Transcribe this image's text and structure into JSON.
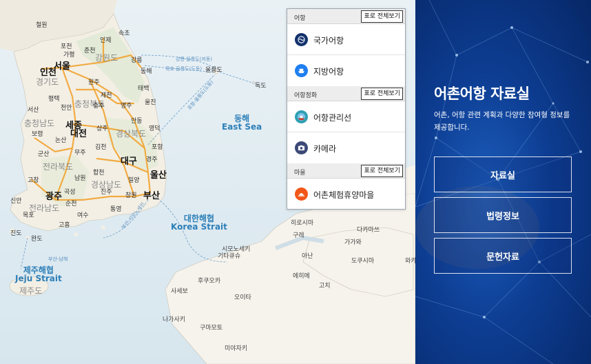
{
  "map": {
    "cities": [
      "인천",
      "서울",
      "세종",
      "대전",
      "대구",
      "울산",
      "광주",
      "부산"
    ],
    "places": [
      "철원",
      "속초",
      "인제",
      "포천",
      "춘천",
      "가평",
      "강릉",
      "동해",
      "원주",
      "태백",
      "제천",
      "영주",
      "서산",
      "평택",
      "천안",
      "충주",
      "울진",
      "상주",
      "안동",
      "영덕",
      "보령",
      "논산",
      "김천",
      "포항",
      "군산",
      "무주",
      "경주",
      "고창",
      "합천",
      "밀양",
      "남원",
      "진주",
      "창원",
      "곡성",
      "순천",
      "통영",
      "신안",
      "목포",
      "여수",
      "고흥",
      "진도",
      "완도"
    ],
    "regions": [
      "강원도",
      "경기도",
      "충청북도",
      "충청남도",
      "경상북도",
      "전라북도",
      "경상남도",
      "전라남도",
      "제주도"
    ],
    "seas": [
      {
        "name": "동해",
        "en": "East Sea"
      },
      {
        "name": "대한해협",
        "en": "Korea Strait"
      },
      {
        "name": "제주해협",
        "en": "Jeju Strait"
      }
    ],
    "islands": [
      "울릉도",
      "독도"
    ],
    "routes": [
      "강릉-울릉도(저동)",
      "묵호-울릉도(도동)",
      "포항-울릉도(도동)",
      "부산-남해",
      "부산-시모노세키"
    ],
    "japan_places": [
      "히로시마",
      "구레",
      "다카마쓰",
      "시모노세키",
      "기타큐슈",
      "가가와",
      "도쿠시마",
      "아난",
      "에히메",
      "고치",
      "후쿠오카",
      "사세보",
      "오이타",
      "나가사키",
      "구마모토",
      "미야자키",
      "와카"
    ]
  },
  "panel": {
    "view_all_label": "표로 전체보기",
    "sections": [
      {
        "title": "어항",
        "items": [
          {
            "label": "국가어항",
            "icon": "national-port-icon",
            "color": "#12326d"
          },
          {
            "label": "지방어항",
            "icon": "local-port-icon",
            "color": "#1f7ff0"
          }
        ]
      },
      {
        "title": "어항정화",
        "items": [
          {
            "label": "어항관리선",
            "icon": "management-ship-icon",
            "color": "#2f9fb2"
          },
          {
            "label": "카메라",
            "icon": "camera-icon",
            "color": "#3d4a78"
          }
        ]
      },
      {
        "title": "마을",
        "items": [
          {
            "label": "어촌체험휴양마을",
            "icon": "village-icon",
            "color": "#f2571a"
          }
        ]
      }
    ]
  },
  "side": {
    "title": "어촌어항 자료실",
    "description": "어촌, 어항 관련 계획과 다양한 참여형 정보를 제공합니다.",
    "buttons": [
      "자료실",
      "법령정보",
      "문헌자료"
    ]
  }
}
